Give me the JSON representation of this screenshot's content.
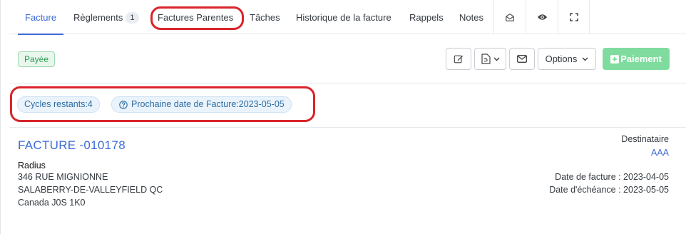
{
  "tabs": [
    {
      "label": "Facture",
      "active": true
    },
    {
      "label": "Règlements",
      "badge": "1"
    },
    {
      "label": "Factures Parentes",
      "highlighted": true
    },
    {
      "label": "Tâches"
    },
    {
      "label": "Historique de la facture"
    },
    {
      "label": "Rappels"
    },
    {
      "label": "Notes"
    }
  ],
  "tab_icons": [
    "envelope-open-icon",
    "eye-icon",
    "fullscreen-icon"
  ],
  "status": {
    "label": "Payée",
    "color": "#2c9f55"
  },
  "toolbar": {
    "edit_icon": "pencil-square-icon",
    "pdf_icon": "pdf-file-icon",
    "email_icon": "envelope-icon",
    "options_label": "Options",
    "payment_label": "Paiement",
    "payment_color": "#7fdc9e"
  },
  "cycle": {
    "remaining": "Cycles restants:4",
    "next_date": "Prochaine date de Facture:2023-05-05"
  },
  "invoice": {
    "title": "FACTURE -010178",
    "company": "Radius",
    "address1": "346 RUE MIGNIONNE",
    "address2": "SALABERRY-DE-VALLEYFIELD QC",
    "address3": "Canada J0S 1K0",
    "recipient_label": "Destinataire",
    "recipient_name": "AAA",
    "invoice_date": "Date de facture : 2023-04-05",
    "due_date": "Date d'échéance : 2023-05-05"
  },
  "colors": {
    "accent": "#3d6cd6",
    "highlight": "#d9242b"
  }
}
